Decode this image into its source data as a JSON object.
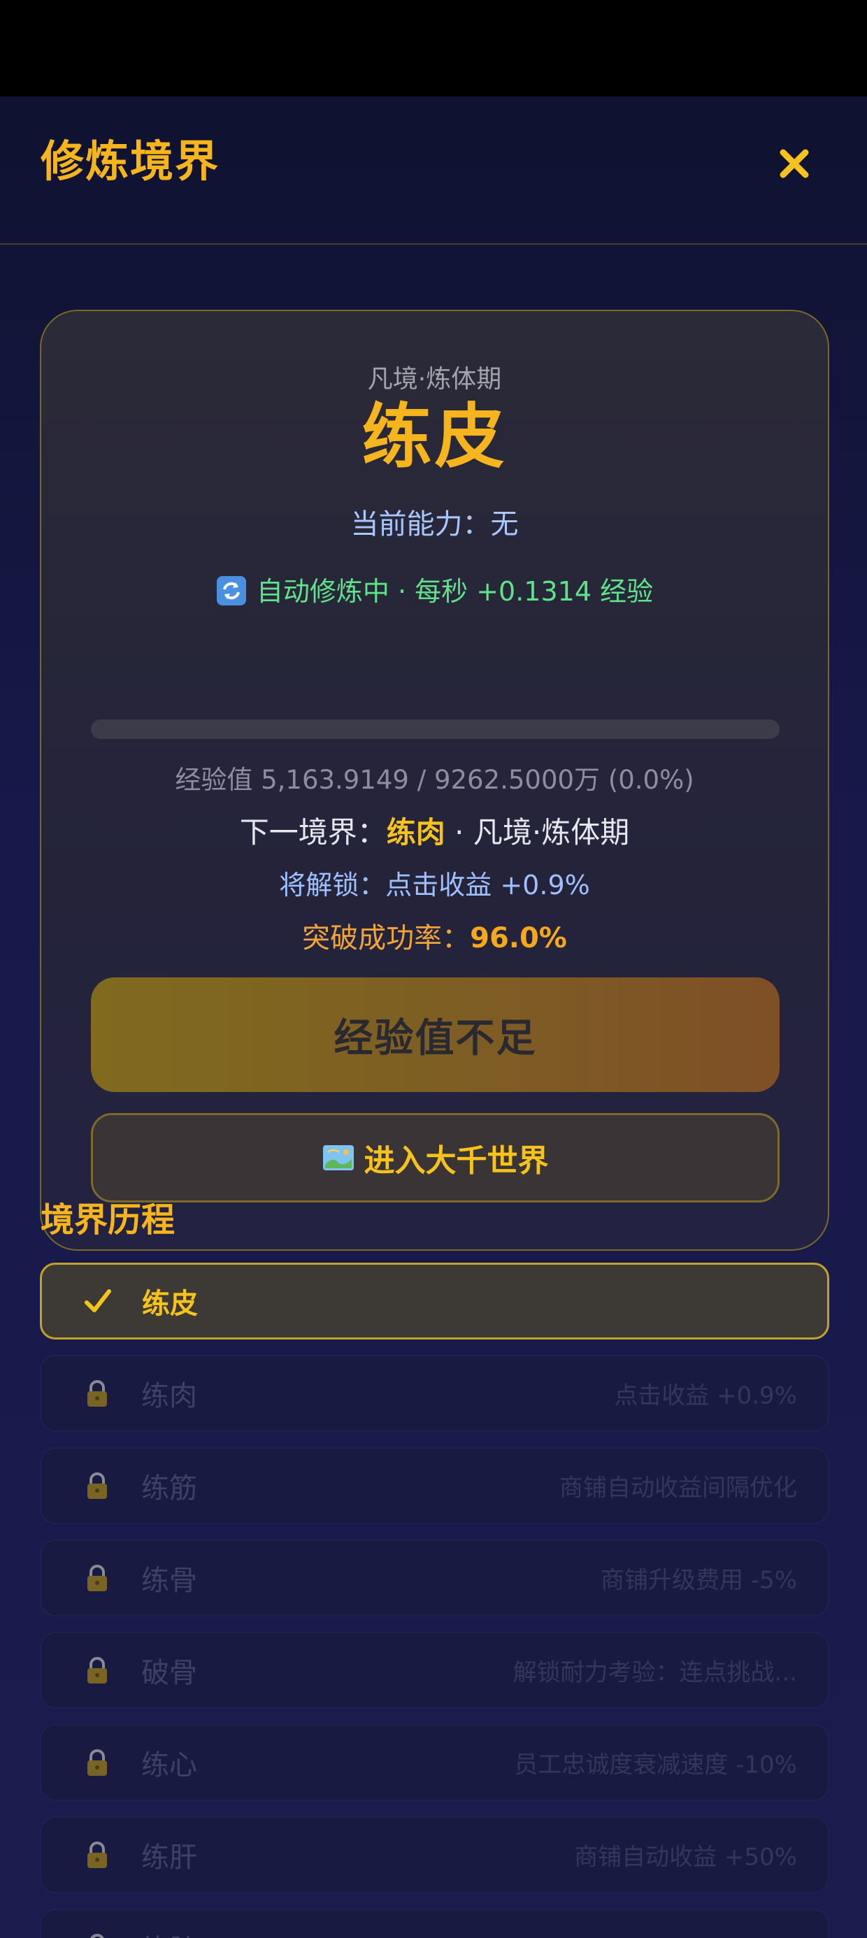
{
  "header": {
    "title": "修炼境界"
  },
  "card": {
    "stage": "凡境·炼体期",
    "realm_name": "练皮",
    "ability": "当前能力：无",
    "auto_cultivation": "自动修炼中 · 每秒 +0.1314 经验",
    "progress_fraction": 0.0,
    "exp_text": "经验值 5,163.9149 / 9262.5000万 (0.0%)",
    "next_realm_prefix": "下一境界：",
    "next_realm_name": "练肉",
    "next_realm_suffix": " · 凡境·炼体期",
    "unlock_text": "将解锁：点击收益 +0.9%",
    "rate_label": "突破成功率：",
    "rate_value": "96.0%",
    "break_button": "经验值不足",
    "world_button": "进入大千世界"
  },
  "history": {
    "title": "境界历程",
    "items": [
      {
        "name": "练皮",
        "desc": "",
        "status": "current"
      },
      {
        "name": "练肉",
        "desc": "点击收益 +0.9%",
        "status": "locked"
      },
      {
        "name": "练筋",
        "desc": "商铺自动收益间隔优化",
        "status": "locked"
      },
      {
        "name": "练骨",
        "desc": "商铺升级费用 -5%",
        "status": "locked"
      },
      {
        "name": "破骨",
        "desc": "解锁耐力考验：连点挑战...",
        "status": "locked"
      },
      {
        "name": "练心",
        "desc": "员工忠诚度衰减速度 -10%",
        "status": "locked"
      },
      {
        "name": "练肝",
        "desc": "商铺自动收益 +50%",
        "status": "locked"
      },
      {
        "name": "练肺",
        "desc": "",
        "status": "locked"
      }
    ]
  },
  "colors": {
    "accent": "#f6b51c",
    "ability_text": "#a8c8ff",
    "auto_text": "#5fe28a",
    "rate_text": "#f0a43a"
  },
  "icons": {
    "close": "close-icon",
    "refresh": "refresh-icon",
    "map": "map-icon",
    "check": "check-icon",
    "lock": "lock-icon"
  }
}
